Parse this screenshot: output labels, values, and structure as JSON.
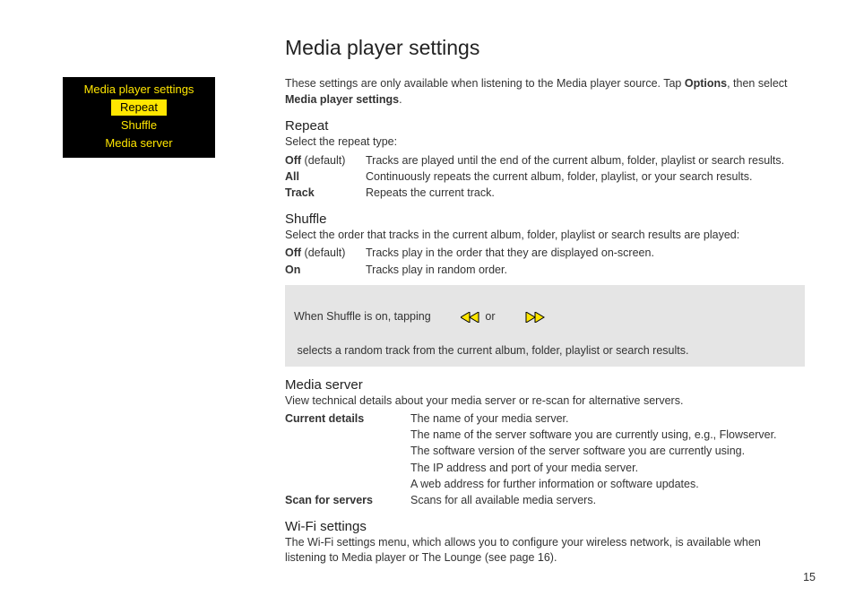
{
  "sidebar": {
    "menu": {
      "title": "Media player settings",
      "items": [
        "Repeat",
        "Shuffle",
        "Media server"
      ],
      "selected_index": 0
    }
  },
  "page": {
    "title": "Media player settings",
    "intro_pre": "These settings are only available when listening to the Media player source. Tap ",
    "intro_bold1": "Options",
    "intro_mid": ", then select ",
    "intro_bold2": "Media player settings",
    "intro_end": ".",
    "page_number": "15"
  },
  "repeat": {
    "heading": "Repeat",
    "sub": "Select the repeat type:",
    "rows": [
      {
        "term": "Off",
        "term_suffix": " (default)",
        "desc": "Tracks are played until the end of the current album, folder, playlist or search results."
      },
      {
        "term": "All",
        "term_suffix": "",
        "desc": "Continuously repeats the current album, folder, playlist, or your search results."
      },
      {
        "term": "Track",
        "term_suffix": "",
        "desc": "Repeats the current track."
      }
    ]
  },
  "shuffle": {
    "heading": "Shuffle",
    "sub": "Select the order that tracks in the current album, folder, playlist or search results are played:",
    "rows": [
      {
        "term": "Off",
        "term_suffix": " (default)",
        "desc": "Tracks play in the order that they are displayed on-screen."
      },
      {
        "term": "On",
        "term_suffix": "",
        "desc": "Tracks play in random order."
      }
    ],
    "note_pre": "When Shuffle is on, tapping ",
    "note_or": " or ",
    "note_post": " selects a random track from the current album, folder, playlist or search results."
  },
  "mediaserver": {
    "heading": "Media server",
    "sub": "View technical details about your media server or re-scan for alternative servers.",
    "rows": [
      {
        "term": "Current details",
        "descs": [
          "The name of your media server.",
          "The name of the server software you are currently using, e.g., Flowserver.",
          "The software version of the server software you are currently using.",
          "The IP address and port of your media server.",
          "A web address for further information or software updates."
        ]
      },
      {
        "term": "Scan for servers",
        "descs": [
          "Scans for all available media servers."
        ]
      }
    ]
  },
  "wifi": {
    "heading": "Wi-Fi settings",
    "body": "The Wi-Fi settings menu, which allows you to configure your wireless network, is available when listening to Media player or The Lounge (see page 16)."
  }
}
